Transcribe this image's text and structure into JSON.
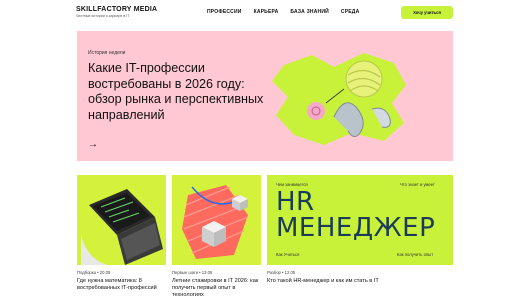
{
  "header": {
    "logo_title": "SKILLFACTORY MEDIA",
    "logo_subtitle": "Честные истории о карьере в IT",
    "nav": [
      "ПРОФЕССИИ",
      "КАРЬЕРА",
      "БАЗА ЗНАНИЙ",
      "СРЕДА"
    ],
    "cta_label": "Хочу учиться"
  },
  "hero": {
    "tag": "История недели",
    "title": "Какие IT-профессии востребованы в 2026 году: обзор рынка и перспективных направлений",
    "arrow": "→",
    "colors": {
      "background": "#ffc8d2",
      "accent": "#c8f23a"
    }
  },
  "cards": [
    {
      "meta": "Подборка • 20.05",
      "title": "Где нужна математика: 8 востребованных IT-профессий",
      "icon": "laptop-code-illustration"
    },
    {
      "meta": "Первые шаги • 13.05",
      "title": "Летние стажировки в IT 2026: как получить первый опыт в технологиях",
      "icon": "cubes-illustration"
    },
    {
      "meta": "Разбор • 12.05",
      "title": "Кто такой HR-менеджер и как им стать в IT",
      "hr": {
        "top_left": "Чем занимается",
        "top_right": "Что знает и умеет",
        "big_line1": "HR",
        "big_line2": "МЕНЕДЖЕР",
        "bottom_left": "Как Учиться",
        "bottom_right": "Как получить опыт"
      }
    }
  ]
}
